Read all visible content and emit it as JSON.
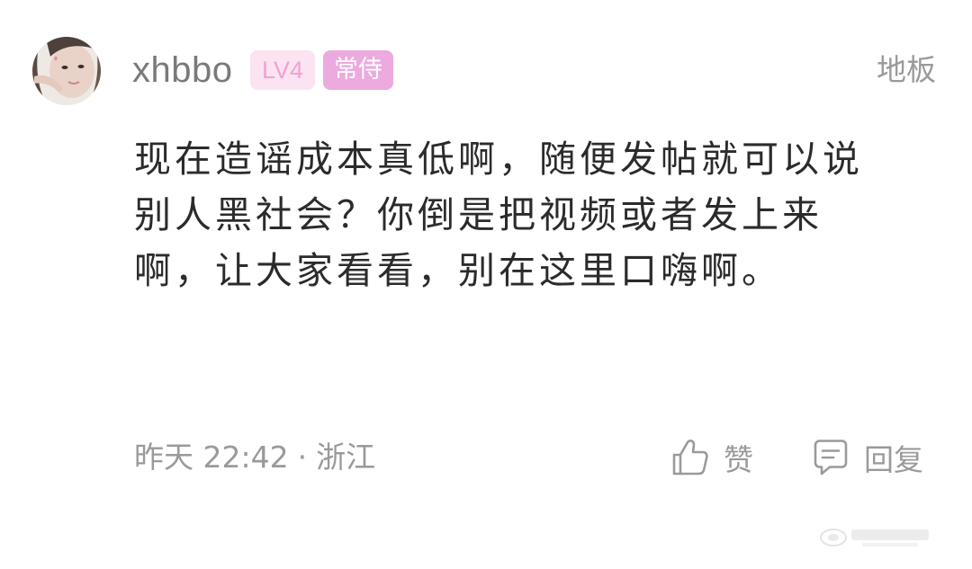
{
  "post": {
    "username": "xhbbo",
    "level_badge": "LV4",
    "role_badge": "常侍",
    "floor_label": "地板",
    "content": "现在造谣成本真低啊，随便发帖就可以说别人黑社会？你倒是把视频或者发上来啊，让大家看看，别在这里口嗨啊。",
    "time": "昨天 22:42",
    "separator": "·",
    "location": "浙江",
    "like_label": "赞",
    "reply_label": "回复"
  },
  "icons": {
    "avatar": "user-avatar-photo",
    "like": "thumbs-up-icon",
    "reply": "comment-icon"
  },
  "colors": {
    "level_badge_bg": "#fbe3f2",
    "level_badge_text": "#f2a1d2",
    "role_badge_bg": "#ecaadf",
    "content_text": "#2b2b2b",
    "secondary_text": "#9a9a9a"
  }
}
